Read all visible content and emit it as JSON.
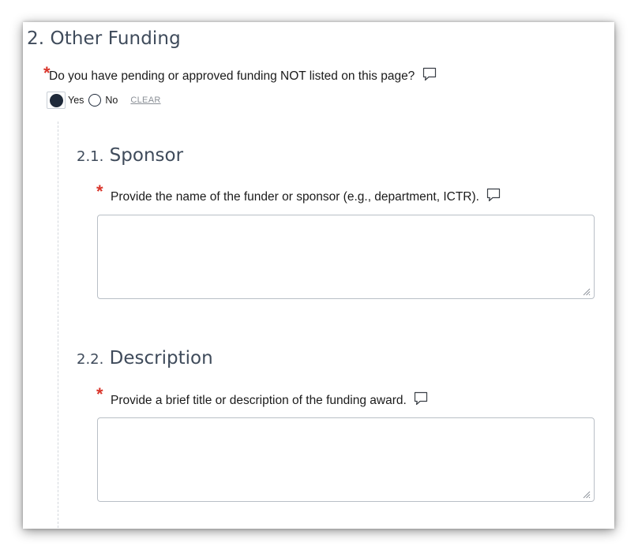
{
  "section": {
    "title": "2. Other Funding",
    "question": "Do you have pending or approved funding NOT listed on this page?",
    "required_mark": "*",
    "options": [
      {
        "label": "Yes",
        "selected": true
      },
      {
        "label": "No",
        "selected": false
      }
    ],
    "clear_label": "CLEAR"
  },
  "subsections": [
    {
      "number": "2.1.",
      "title": "Sponsor",
      "required_mark": "*",
      "question": "Provide the name of the funder or sponsor (e.g., department, ICTR).",
      "value": ""
    },
    {
      "number": "2.2.",
      "title": "Description",
      "required_mark": "*",
      "question": "Provide a brief title or description of the funding award.",
      "value": ""
    }
  ],
  "icons": {
    "comment": "comment-bubble-icon",
    "resize": "resize-grip-icon"
  },
  "colors": {
    "heading": "#3f4b5b",
    "required": "#d9352b",
    "radio_selected": "#1f2a3a",
    "clear_link": "#8a8f96"
  }
}
